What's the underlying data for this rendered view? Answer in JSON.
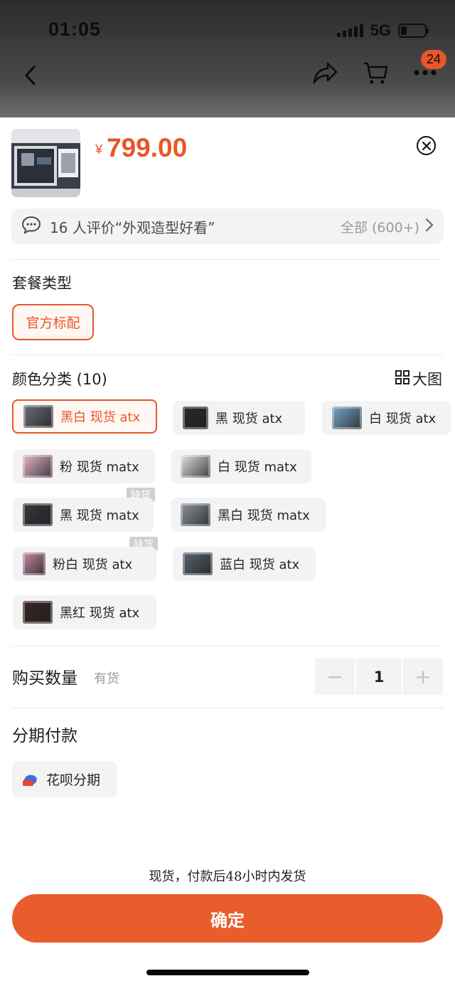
{
  "status": {
    "time": "01:05",
    "network": "5G",
    "battery_level": 0.25
  },
  "nav": {
    "back_icon": "chevron-left-icon",
    "share_icon": "share-icon",
    "cart_icon": "cart-icon",
    "more_icon": "more-icon",
    "badge_count": "24"
  },
  "product": {
    "price_currency": "¥",
    "price": "799.00",
    "close_icon": "close-circle-icon"
  },
  "review": {
    "icon": "chat-bubble-icon",
    "text": "16 人评价“外观造型好看”",
    "all_label": "全部 (600+)"
  },
  "package": {
    "title": "套餐类型",
    "options": [
      "官方标配"
    ],
    "selected": "官方标配"
  },
  "color": {
    "title": "颜色分类 (10)",
    "big_image_label": "大图",
    "out_of_stock_label": "缺货",
    "options": [
      {
        "label": "黑白 现货 atx",
        "selected": true,
        "thumb_color": "#6b6f78"
      },
      {
        "label": "黑 现货  atx",
        "selected": false,
        "thumb_color": "#2a2a2a"
      },
      {
        "label": "白 现货 atx",
        "selected": false,
        "thumb_color": "#7aa8c8"
      },
      {
        "label": "粉 现货 matx",
        "selected": false,
        "thumb_color": "#e8b6cf"
      },
      {
        "label": "白 现货 matx",
        "selected": false,
        "thumb_color": "#dfe4e8"
      },
      {
        "label": "黑 现货 matx",
        "selected": false,
        "thumb_color": "#34393e",
        "out_of_stock": true
      },
      {
        "label": "黑白 现货 matx",
        "selected": false,
        "thumb_color": "#8e969c"
      },
      {
        "label": "粉白 现货 atx",
        "selected": false,
        "thumb_color": "#c98aa8",
        "out_of_stock": true
      },
      {
        "label": "蓝白 现货 atx",
        "selected": false,
        "thumb_color": "#5a6470"
      },
      {
        "label": "黑红 现货 atx",
        "selected": false,
        "thumb_color": "#3a2424"
      }
    ]
  },
  "quantity": {
    "label": "购买数量",
    "stock": "有货",
    "value": "1",
    "minus": "−",
    "plus": "+"
  },
  "installment": {
    "title": "分期付款",
    "option": "花呗分期",
    "icon": "huabei-icon"
  },
  "footer": {
    "ship_note": "现货，付款后48小时内发货",
    "confirm_label": "确定"
  },
  "colors": {
    "accent": "#e8562a",
    "chip_bg": "#f3f3f3"
  }
}
